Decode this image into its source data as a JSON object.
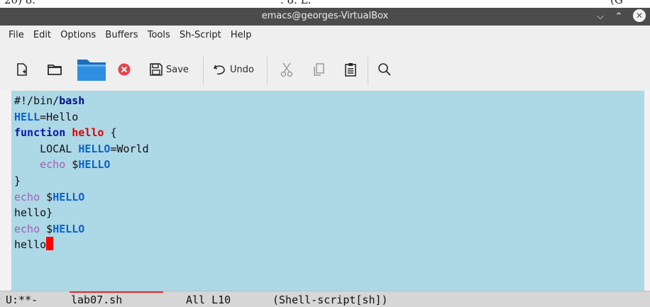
{
  "top_strip": {
    "left": "20) 8.",
    "middle": ". 8. L.",
    "right": "(G"
  },
  "window": {
    "title": "emacs@georges-VirtualBox",
    "minimize_glyph": "⌵",
    "maximize_glyph": "⌃",
    "close_glyph": "✕"
  },
  "menu": [
    "File",
    "Edit",
    "Options",
    "Buffers",
    "Tools",
    "Sh-Script",
    "Help"
  ],
  "toolbar": {
    "save_label": "Save",
    "undo_label": "Undo",
    "icons": [
      "new-file-icon",
      "open-file-icon",
      "folder-icon",
      "close-buffer-icon",
      "save-icon",
      "undo-icon",
      "cut-icon",
      "copy-icon",
      "paste-icon",
      "search-icon"
    ]
  },
  "editor": {
    "line1": {
      "a": "#!/bin/",
      "b": "bash"
    },
    "line2": {
      "var": "HELL",
      "rest": "=Hello"
    },
    "line3": {
      "kw": "function",
      "sp": " ",
      "name": "hello",
      "rest": " {"
    },
    "line4": {
      "indent": "    LOCAL ",
      "var": "HELLO",
      "rest": "=World"
    },
    "line5": {
      "indent": "    ",
      "cmd": "echo",
      "sp": " $",
      "var": "HELLO"
    },
    "line6": {
      "text": "}"
    },
    "line7": {
      "cmd": "echo",
      "sp": " $",
      "var": "HELLO"
    },
    "line8": {
      "text": "hello}"
    },
    "line9": {
      "cmd": "echo",
      "sp": " $",
      "var": "HELLO"
    },
    "line10": {
      "text": "hello"
    }
  },
  "colors": {
    "region_background": "#add8e6",
    "cursor": "#ff0000",
    "keyword": "#001080",
    "variable": "#0a63c9",
    "function_name": "#e00000",
    "builtin": "#a35db8"
  },
  "modeline": {
    "status": "U:**-",
    "buffer": "lab07.sh",
    "position": "All L10",
    "mode": "(Shell-script[sh])"
  }
}
